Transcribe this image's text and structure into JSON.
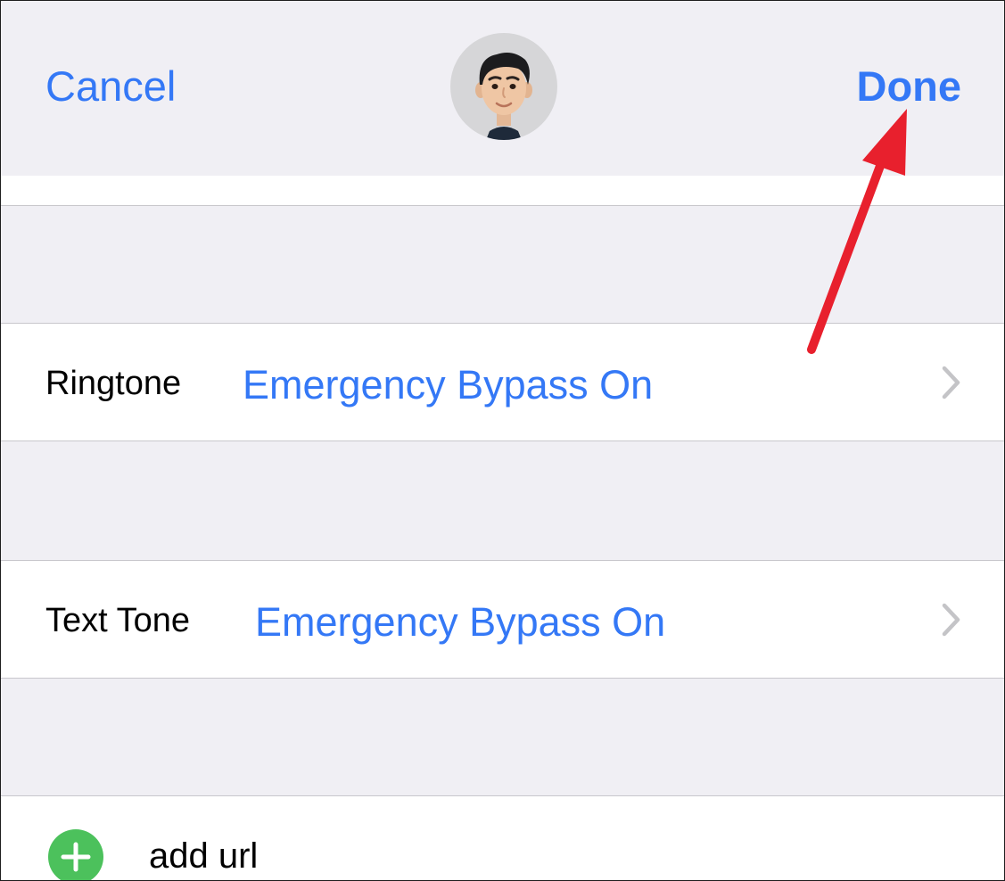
{
  "nav": {
    "cancel_label": "Cancel",
    "done_label": "Done"
  },
  "rows": [
    {
      "label": "Ringtone",
      "value": "Emergency Bypass On"
    },
    {
      "label": "Text Tone",
      "value": "Emergency Bypass On"
    }
  ],
  "add_url": {
    "label": "add url"
  },
  "icons": {
    "avatar": "memoji-avatar",
    "chevron": "chevron-right-icon",
    "add": "plus-circle-icon",
    "annotation": "red-arrow"
  },
  "colors": {
    "accent": "#3478f6",
    "background": "#f0eff4",
    "cell": "#ffffff",
    "separator": "#c8c7cc",
    "add_green": "#4cc15c",
    "annotation_red": "#e8202d"
  }
}
